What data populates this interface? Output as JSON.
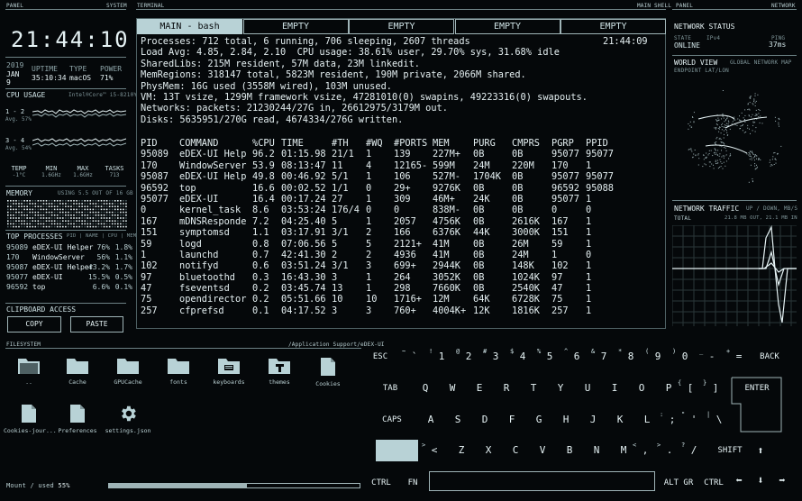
{
  "headers": {
    "panel_left": "PANEL",
    "system": "SYSTEM",
    "terminal": "TERMINAL",
    "main_shell": "MAIN SHELL",
    "panel_right": "PANEL",
    "network": "NETWORK",
    "filesystem": "FILESYSTEM",
    "fs_path": "/Application Support/eDEX-UI"
  },
  "clock": "21:44:10",
  "sysinfo": {
    "year": "2019",
    "date": "JAN 9",
    "uptime_label": "UPTIME",
    "uptime": "35:10:34",
    "type_label": "TYPE",
    "type": "macOS",
    "power_label": "POWER",
    "power": "71%"
  },
  "cpu": {
    "title": "CPU USAGE",
    "model": "Intel®Core™ i5-8210Y",
    "row1_label": "1 - 2",
    "row1_avg": "Avg. 57%",
    "row2_label": "3 - 4",
    "row2_avg": "Avg. 54%",
    "stats": [
      {
        "k": "TEMP",
        "v": "-1°C"
      },
      {
        "k": "MIN",
        "v": "1.6GHz"
      },
      {
        "k": "MAX",
        "v": "1.6GHz"
      },
      {
        "k": "TASKS",
        "v": "713"
      }
    ]
  },
  "memory": {
    "title": "MEMORY",
    "usage": "USING 5.5 OUT OF 16 GB"
  },
  "top_processes": {
    "title": "TOP PROCESSES",
    "cols": "PID | NAME | CPU | MEM",
    "rows": [
      {
        "pid": "95089",
        "name": "eDEX-UI Helper",
        "cpu": "76%",
        "mem": "1.8%"
      },
      {
        "pid": "170",
        "name": "WindowServer",
        "cpu": "56%",
        "mem": "1.1%"
      },
      {
        "pid": "95087",
        "name": "eDEX-UI Helper",
        "cpu": "43.2%",
        "mem": "1.7%"
      },
      {
        "pid": "95077",
        "name": "eDEX-UI",
        "cpu": "15.5%",
        "mem": "0.5%"
      },
      {
        "pid": "96592",
        "name": "top",
        "cpu": "6.6%",
        "mem": "0.1%"
      }
    ]
  },
  "clipboard": {
    "title": "CLIPBOARD ACCESS",
    "copy": "COPY",
    "paste": "PASTE"
  },
  "tabs": [
    "MAIN - bash",
    "EMPTY",
    "EMPTY",
    "EMPTY",
    "EMPTY"
  ],
  "terminal": {
    "time": "21:44:09",
    "lines": [
      "Processes: 712 total, 6 running, 706 sleeping, 2607 threads",
      "Load Avg: 4.85, 2.84, 2.10  CPU usage: 38.61% user, 29.70% sys, 31.68% idle",
      "SharedLibs: 215M resident, 57M data, 23M linkedit.",
      "MemRegions: 318147 total, 5823M resident, 190M private, 2066M shared.",
      "PhysMem: 16G used (3558M wired), 103M unused.",
      "VM: 13T vsize, 1299M framework vsize, 47281010(0) swapins, 49223316(0) swapouts.",
      "Networks: packets: 21230244/27G in, 26612975/3179M out.",
      "Disks: 5635951/270G read, 4674334/276G written."
    ],
    "columns": [
      "PID",
      "COMMAND",
      "%CPU",
      "TIME",
      "#TH",
      "#WQ",
      "#PORTS",
      "MEM",
      "PURG",
      "CMPRS",
      "PGRP",
      "PPID"
    ],
    "rows": [
      [
        "95089",
        "eDEX-UI Help",
        "96.2",
        "01:15.98",
        "21/1",
        "1",
        "139",
        "227M+",
        "0B",
        "0B",
        "95077",
        "95077"
      ],
      [
        "170",
        "WindowServer",
        "53.9",
        "08:13:47",
        "11",
        "4",
        "12165-",
        "599M",
        "24M",
        "220M",
        "170",
        "1"
      ],
      [
        "95087",
        "eDEX-UI Help",
        "49.8",
        "00:46.92",
        "5/1",
        "1",
        "106",
        "527M-",
        "1704K",
        "0B",
        "95077",
        "95077"
      ],
      [
        "96592",
        "top",
        "16.6",
        "00:02.52",
        "1/1",
        "0",
        "29+",
        "9276K",
        "0B",
        "0B",
        "96592",
        "95088"
      ],
      [
        "95077",
        "eDEX-UI",
        "16.4",
        "00:17.24",
        "27",
        "1",
        "309",
        "46M+",
        "24K",
        "0B",
        "95077",
        "1"
      ],
      [
        "0",
        "kernel_task",
        "8.6",
        "03:53:24",
        "176/4",
        "0",
        "0",
        "838M-",
        "0B",
        "0B",
        "0",
        "0"
      ],
      [
        "167",
        "mDNSResponde",
        "7.2",
        "04:25.40",
        "5",
        "1",
        "2057",
        "4756K",
        "0B",
        "2616K",
        "167",
        "1"
      ],
      [
        "151",
        "symptomsd",
        "1.1",
        "03:17.91",
        "3/1",
        "2",
        "166",
        "6376K",
        "44K",
        "3000K",
        "151",
        "1"
      ],
      [
        "59",
        "logd",
        "0.8",
        "07:06.56",
        "5",
        "5",
        "2121+",
        "41M",
        "0B",
        "26M",
        "59",
        "1"
      ],
      [
        "1",
        "launchd",
        "0.7",
        "42:41.30",
        "2",
        "2",
        "4936",
        "41M",
        "0B",
        "24M",
        "1",
        "0"
      ],
      [
        "102",
        "notifyd",
        "0.6",
        "03:51.24",
        "3/1",
        "3",
        "699+",
        "2944K",
        "0B",
        "148K",
        "102",
        "1"
      ],
      [
        "97",
        "bluetoothd",
        "0.3",
        "16:43.30",
        "3",
        "1",
        "264",
        "3052K",
        "0B",
        "1024K",
        "97",
        "1"
      ],
      [
        "47",
        "fseventsd",
        "0.2",
        "03:45.74",
        "13",
        "1",
        "298",
        "7660K",
        "0B",
        "2540K",
        "47",
        "1"
      ],
      [
        "75",
        "opendirector",
        "0.2",
        "05:51.66",
        "10",
        "10",
        "1716+",
        "12M",
        "64K",
        "6728K",
        "75",
        "1"
      ],
      [
        "257",
        "cfprefsd",
        "0.1",
        "04:17.52",
        "3",
        "3",
        "760+",
        "4004K+",
        "12K",
        "1816K",
        "257",
        "1"
      ]
    ]
  },
  "network": {
    "status_title": "NETWORK STATUS",
    "state_label": "STATE",
    "state_ip": "IPv4",
    "ping_label": "PING",
    "state": "ONLINE",
    "ping": "37ms",
    "world_title": "WORLD VIEW",
    "world_sub": "GLOBAL NETWORK MAP",
    "endpoint": "ENDPOINT LAT/LON",
    "traffic_title": "NETWORK TRAFFIC",
    "traffic_sub": "UP / DOWN, MB/S",
    "total_label": "TOTAL",
    "total": "21.8 MB OUT, 21.1 MB IN"
  },
  "filesystem": {
    "items": [
      {
        "name": "..",
        "icon": "folder-up-icon"
      },
      {
        "name": "Cache",
        "icon": "folder-icon"
      },
      {
        "name": "GPUCache",
        "icon": "folder-icon"
      },
      {
        "name": "fonts",
        "icon": "folder-icon"
      },
      {
        "name": "keyboards",
        "icon": "keyboard-folder-icon"
      },
      {
        "name": "themes",
        "icon": "themes-folder-icon"
      },
      {
        "name": "Cookies",
        "icon": "file-icon"
      },
      {
        "name": "Cookies-jour...",
        "icon": "file-icon"
      },
      {
        "name": "Preferences",
        "icon": "file-icon"
      },
      {
        "name": "settings.json",
        "icon": "gear-icon"
      }
    ],
    "mount_label": "Mount / used",
    "mount_used": "55%",
    "mount_fraction": 0.55
  },
  "keyboard": {
    "row1": [
      "ESC",
      "`",
      "1",
      "2",
      "3",
      "4",
      "5",
      "6",
      "7",
      "8",
      "9",
      "0",
      "-",
      "=",
      "BACK"
    ],
    "row1_sup": [
      "",
      "~",
      "!",
      "@",
      "#",
      "$",
      "%",
      "^",
      "&",
      "*",
      "(",
      ")",
      "_",
      "+",
      ""
    ],
    "row2": [
      "TAB",
      "Q",
      "W",
      "E",
      "R",
      "T",
      "Y",
      "U",
      "I",
      "O",
      "P",
      "[",
      "]",
      "ENTER"
    ],
    "row2_sup": [
      "",
      "",
      "",
      "",
      "",
      "",
      "",
      "",
      "",
      "",
      "",
      "{",
      "}",
      ""
    ],
    "row3": [
      "CAPS",
      "A",
      "S",
      "D",
      "F",
      "G",
      "H",
      "J",
      "K",
      "L",
      ";",
      "'",
      "\\"
    ],
    "row3_sup": [
      "",
      "",
      "",
      "",
      "",
      "",
      "",
      "",
      "",
      "",
      ":",
      "\"",
      "|"
    ],
    "row4": [
      "<",
      "Z",
      "X",
      "C",
      "V",
      "B",
      "N",
      "M",
      ",",
      ".",
      "/",
      "SHIFT"
    ],
    "row4_sup": [
      ">",
      "",
      "",
      "",
      "",
      "",
      "",
      "",
      "<",
      ">",
      "?",
      ""
    ],
    "row5": [
      "CTRL",
      "FN",
      "ALT GR",
      "CTRL"
    ]
  }
}
